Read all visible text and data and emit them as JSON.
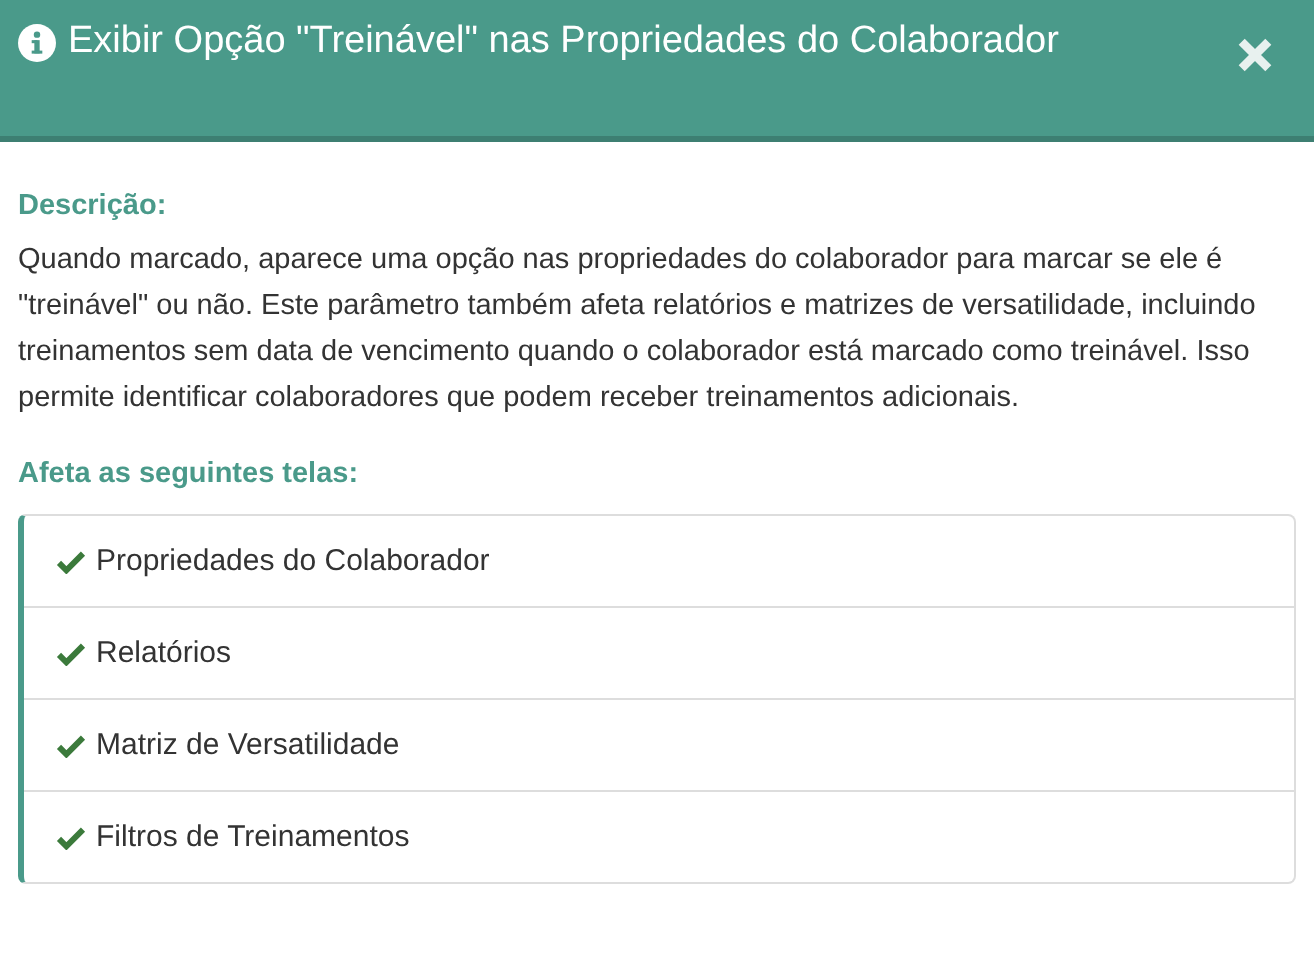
{
  "dialog": {
    "title": "Exibir Opção \"Treinável\" nas Propriedades do Colaborador"
  },
  "description": {
    "label": "Descrição:",
    "text": "Quando marcado, aparece uma opção nas propriedades do colaborador para marcar se ele é \"treinável\" ou não. Este parâmetro também afeta relatórios e matrizes de versatilidade, incluindo treinamentos sem data de vencimento quando o colaborador está marcado como treinável. Isso permite identificar colaboradores que podem receber treinamentos adicionais."
  },
  "affected_screens": {
    "label": "Afeta as seguintes telas:",
    "items": [
      {
        "label": "Propriedades do Colaborador"
      },
      {
        "label": "Relatórios"
      },
      {
        "label": "Matriz de Versatilidade"
      },
      {
        "label": "Filtros de Treinamentos"
      }
    ]
  }
}
